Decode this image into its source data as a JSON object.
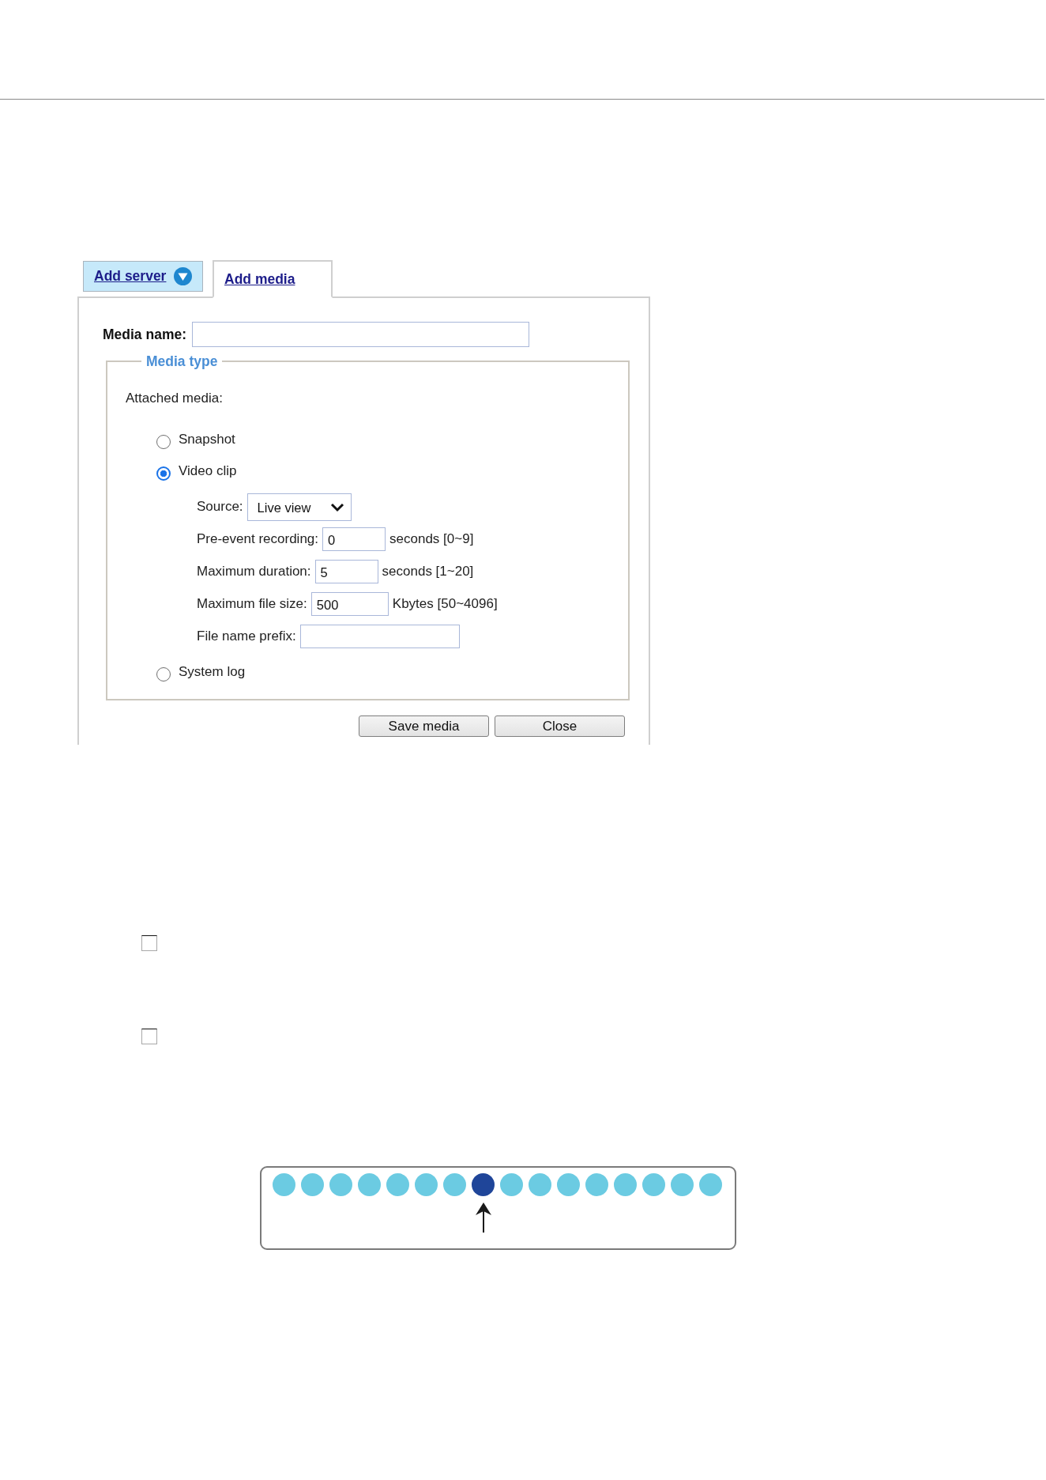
{
  "tabs": [
    {
      "label": "Add server",
      "selected": false,
      "dropdown": true
    },
    {
      "label": "Add media",
      "selected": true,
      "dropdown": false
    }
  ],
  "media_name": {
    "label": "Media name:"
  },
  "media_type": {
    "title": "Media type",
    "label": "Attached media:",
    "options": [
      {
        "label": "Snapshot",
        "selected": false
      },
      {
        "label": "Video clip",
        "selected": true,
        "fields": [
          {
            "kind": "select",
            "label": "Source:",
            "value": "Live view"
          },
          {
            "kind": "input",
            "label": "Pre-event recording:",
            "value": "0",
            "unit": "seconds [0~9]"
          },
          {
            "kind": "input",
            "label": "Maximum duration:",
            "value": "5",
            "unit": "seconds [1~20]"
          },
          {
            "kind": "input",
            "label": "Maximum file size:",
            "value": "500",
            "unit": "Kbytes [50~4096]"
          },
          {
            "kind": "input",
            "label": "File name prefix:"
          }
        ]
      },
      {
        "label": "System log",
        "selected": false
      }
    ]
  },
  "buttons": [
    "Save media",
    "Close"
  ],
  "checkboxes": [
    {
      "checked": false
    },
    {
      "checked": false
    }
  ],
  "dots": [
    {
      "selected": false
    },
    {
      "selected": false
    },
    {
      "selected": false
    },
    {
      "selected": false
    },
    {
      "selected": false
    },
    {
      "selected": false
    },
    {
      "selected": false
    },
    {
      "selected": true
    },
    {
      "selected": false
    },
    {
      "selected": false
    },
    {
      "selected": false
    },
    {
      "selected": false
    },
    {
      "selected": false
    },
    {
      "selected": false
    },
    {
      "selected": false
    },
    {
      "selected": false
    }
  ]
}
